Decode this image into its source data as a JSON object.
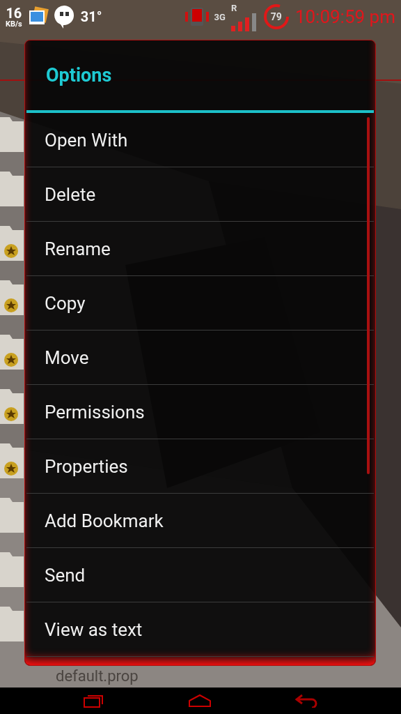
{
  "status_bar": {
    "speed": "16",
    "speed_unit": "KB/s",
    "temperature": "31°",
    "network": "3G",
    "roaming": "R",
    "battery": "79",
    "time": "10:09:59 pm"
  },
  "file_list": {
    "footer_item": "default.prop"
  },
  "dialog": {
    "title": "Options",
    "items": [
      {
        "label": "Open With"
      },
      {
        "label": "Delete"
      },
      {
        "label": "Rename"
      },
      {
        "label": "Copy"
      },
      {
        "label": "Move"
      },
      {
        "label": "Permissions"
      },
      {
        "label": "Properties"
      },
      {
        "label": "Add Bookmark"
      },
      {
        "label": "Send"
      },
      {
        "label": "View as text"
      }
    ]
  }
}
